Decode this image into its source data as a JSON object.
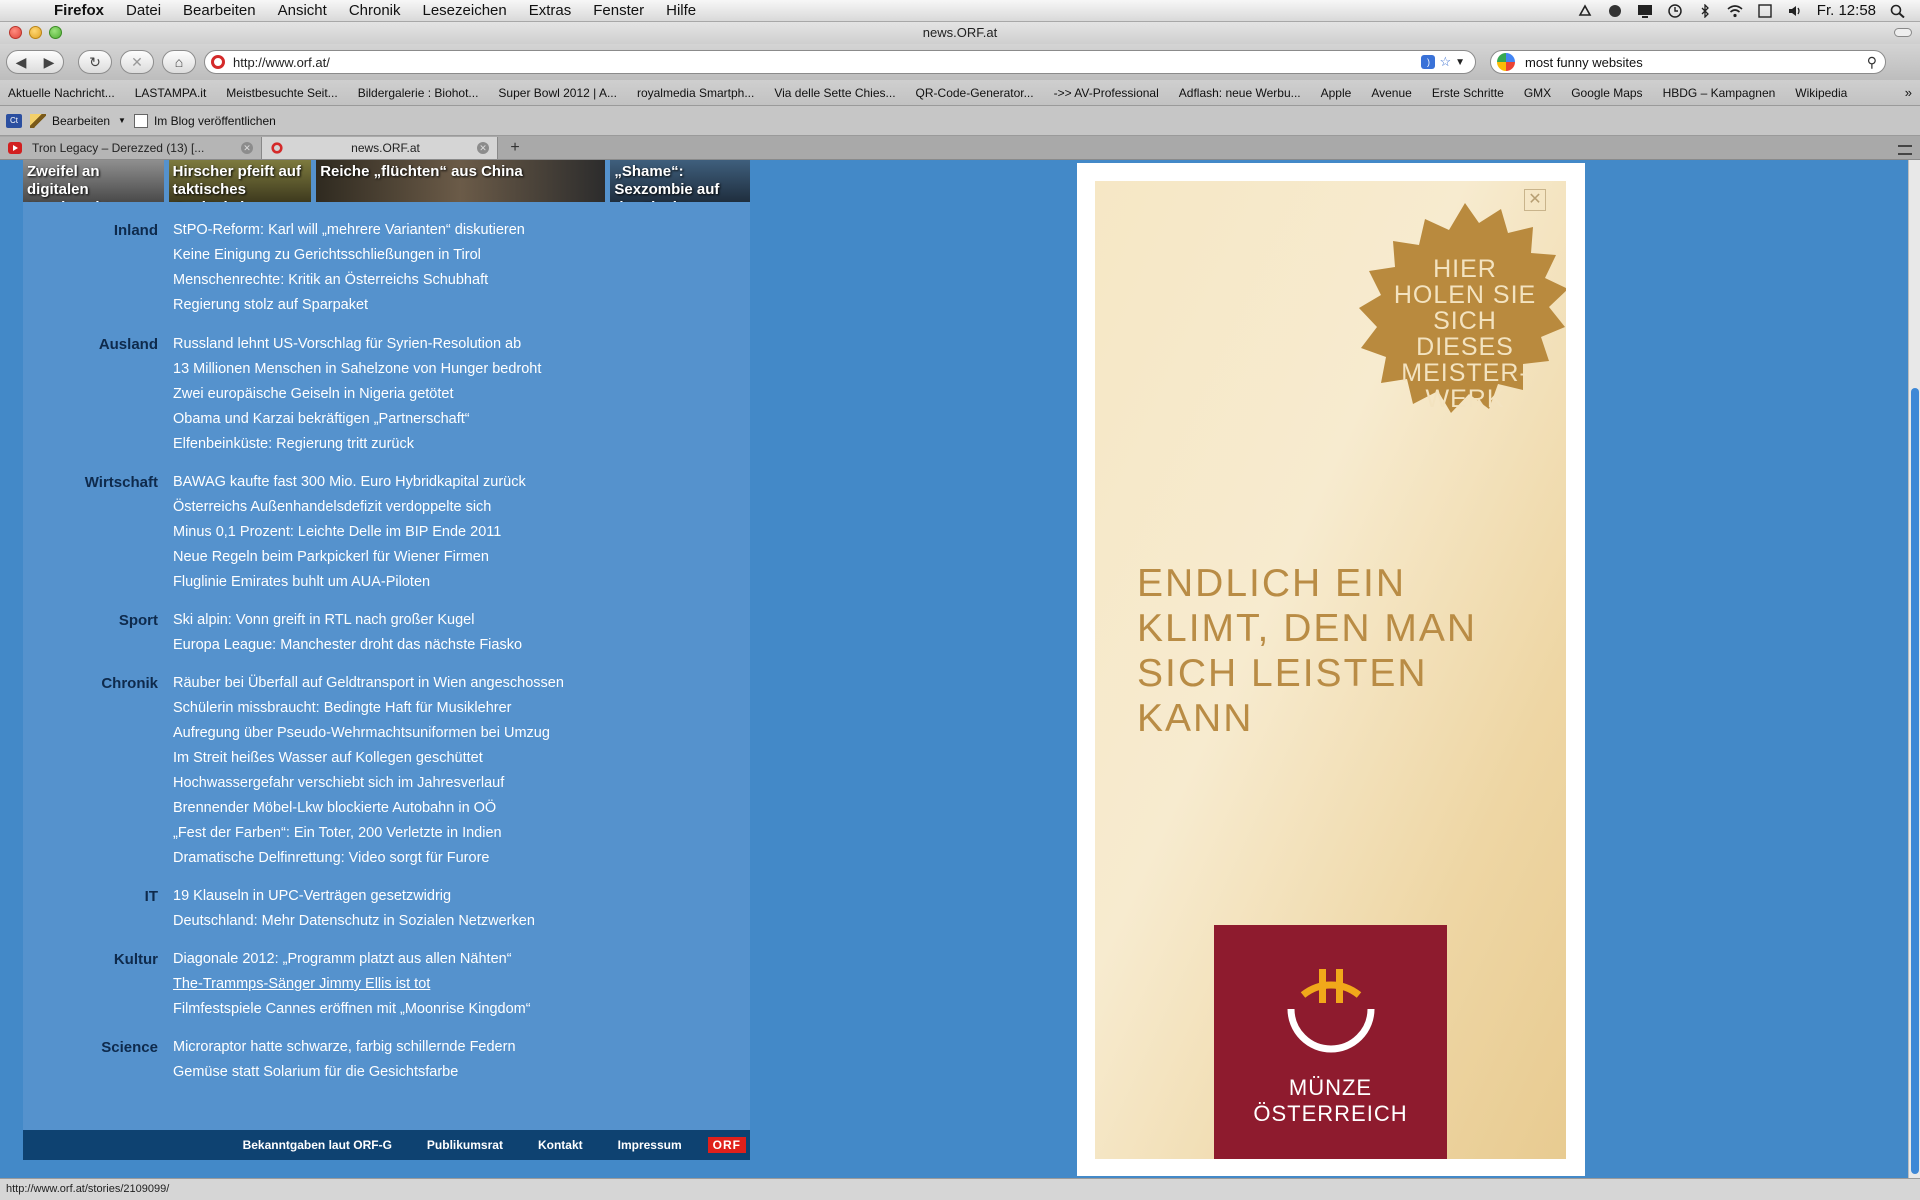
{
  "menubar": {
    "app": "Firefox",
    "items": [
      "Datei",
      "Bearbeiten",
      "Ansicht",
      "Chronik",
      "Lesezeichen",
      "Extras",
      "Fenster",
      "Hilfe"
    ],
    "clock": "Fr. 12:58"
  },
  "window": {
    "title": "news.ORF.at"
  },
  "toolbar": {
    "url": "http://www.orf.at/",
    "search_value": "most funny websites"
  },
  "bookmarks": [
    "Aktuelle Nachricht...",
    "LASTAMPA.it",
    "Meistbesuchte Seit...",
    "Bildergalerie : Biohot...",
    "Super Bowl 2012 | A...",
    "royalmedia Smartph...",
    "Via delle Sette Chies...",
    "QR-Code-Generator...",
    "->> AV-Professional",
    "Adflash: neue Werbu...",
    "Apple",
    "Avenue",
    "Erste Schritte",
    "GMX",
    "Google Maps",
    "HBDG – Kampagnen",
    "Wikipedia"
  ],
  "blogbar": {
    "edit": "Bearbeiten",
    "publish": "Im Blog veröffentlichen"
  },
  "tabs": [
    {
      "title": "Tron Legacy – Derezzed (13) [..."
    },
    {
      "title": "news.ORF.at"
    }
  ],
  "teasers": [
    "Zweifel an digitalen Krankenakten",
    "Hirscher pfeift auf taktisches Geplänkel",
    "Reiche „flüchten“ aus China",
    "„Shame“: Sexzombie auf der Flucht"
  ],
  "sections": [
    {
      "name": "Inland",
      "items": [
        "StPO-Reform: Karl will „mehrere Varianten“ diskutieren",
        "Keine Einigung zu Gerichtsschließungen in Tirol",
        "Menschenrechte: Kritik an Österreichs Schubhaft",
        "Regierung stolz auf Sparpaket"
      ]
    },
    {
      "name": "Ausland",
      "items": [
        "Russland lehnt US-Vorschlag für Syrien-Resolution ab",
        "13 Millionen Menschen in Sahelzone von Hunger bedroht",
        "Zwei europäische Geiseln in Nigeria getötet",
        "Obama und Karzai bekräftigen „Partnerschaft“",
        "Elfenbeinküste: Regierung tritt zurück"
      ]
    },
    {
      "name": "Wirtschaft",
      "items": [
        "BAWAG kaufte fast 300 Mio. Euro Hybridkapital zurück",
        "Österreichs Außenhandelsdefizit verdoppelte sich",
        "Minus 0,1 Prozent: Leichte Delle im BIP Ende 2011",
        "Neue Regeln beim Parkpickerl für Wiener Firmen",
        "Fluglinie Emirates buhlt um AUA-Piloten"
      ]
    },
    {
      "name": "Sport",
      "items": [
        "Ski alpin: Vonn greift in RTL nach großer Kugel",
        "Europa League: Manchester droht das nächste Fiasko"
      ]
    },
    {
      "name": "Chronik",
      "items": [
        "Räuber bei Überfall auf Geldtransport in Wien angeschossen",
        "Schülerin missbraucht: Bedingte Haft für Musiklehrer",
        "Aufregung über Pseudo-Wehrmachtsuniformen bei Umzug",
        "Im Streit heißes Wasser auf Kollegen geschüttet",
        "Hochwassergefahr verschiebt sich im Jahresverlauf",
        "Brennender Möbel-Lkw blockierte Autobahn in OÖ",
        "„Fest der Farben“: Ein Toter, 200 Verletzte in Indien",
        "Dramatische Delfinrettung: Video sorgt für Furore"
      ]
    },
    {
      "name": "IT",
      "items": [
        "19 Klauseln in UPC-Verträgen gesetzwidrig",
        "Deutschland: Mehr Datenschutz in Sozialen Netzwerken"
      ]
    },
    {
      "name": "Kultur",
      "items": [
        "Diagonale 2012: „Programm platzt aus allen Nähten“",
        "The-Trammps-Sänger Jimmy Ellis ist tot",
        "Filmfestspiele Cannes eröffnen mit „Moonrise Kingdom“"
      ]
    },
    {
      "name": "Science",
      "items": [
        "Microraptor hatte schwarze, farbig schillernde Federn",
        "Gemüse statt Solarium für die Gesichtsfarbe"
      ]
    }
  ],
  "footer": {
    "links": [
      "Bekanntgaben laut ORF-G",
      "Publikumsrat",
      "Kontakt",
      "Impressum"
    ],
    "logo": "ORF"
  },
  "ad": {
    "badge_lines": [
      "HIER",
      "HOLEN SIE",
      "SICH DIESES",
      "MEISTER-",
      "WERK"
    ],
    "headline_lines": [
      "ENDLICH EIN",
      "KLIMT, DEN MAN",
      "SICH LEISTEN",
      "KANN"
    ],
    "brand_lines": [
      "MÜNZE",
      "ÖSTERREICH"
    ],
    "close": "✕"
  },
  "status": "http://www.orf.at/stories/2109099/",
  "colors": {
    "page_bg": "#4389c8",
    "column_bg": "#5592cd",
    "section_label": "#0e2a4c",
    "footer_bg": "#0e4271",
    "ad_gold": "#b98c45",
    "mint_red": "#8e1b2e"
  }
}
